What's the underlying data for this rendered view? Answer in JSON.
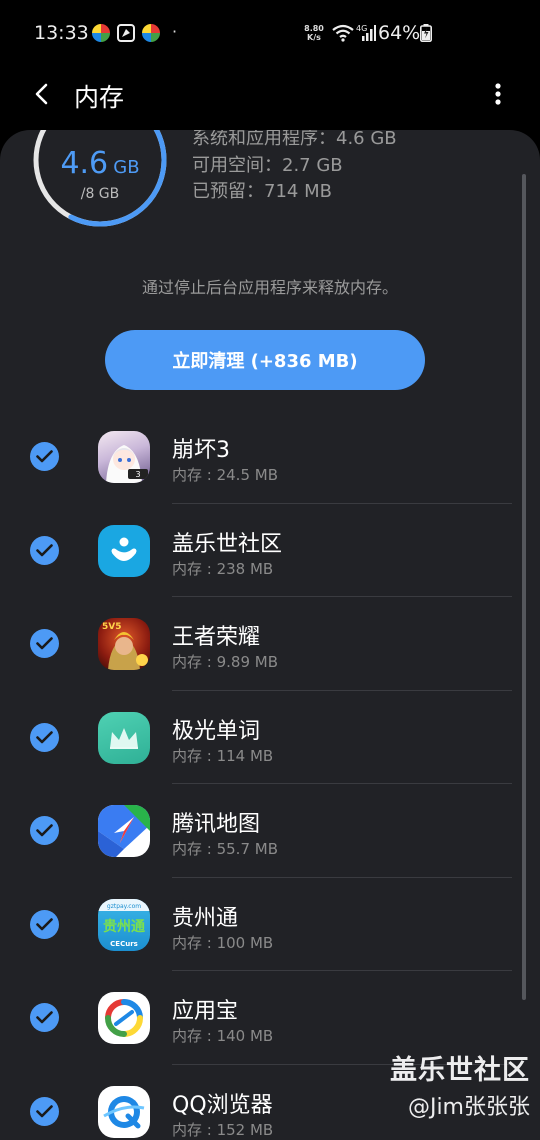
{
  "status_bar": {
    "time": "13:33",
    "dot": "·",
    "net_speed_value": "8.80",
    "net_speed_unit": "K/s",
    "network_type": "4G",
    "battery_percent": "64%"
  },
  "app_bar": {
    "title": "内存",
    "back_icon": "chevron-left-icon",
    "more_icon": "more-vert-icon"
  },
  "memory": {
    "used_value": "4.6",
    "used_unit": "GB",
    "total": "/8 GB",
    "used_fraction": 0.575,
    "stats": [
      "系统和应用程序：4.6 GB",
      "可用空间：2.7 GB",
      "已预留：714 MB"
    ]
  },
  "hint": "通过停止后台应用程序来释放内存。",
  "clean_button_label": "立即清理 (+836 MB)",
  "apps": [
    {
      "name": "崩坏3",
      "memory": "内存 : 24.5 MB",
      "checked": true,
      "icon": "honkai-icon"
    },
    {
      "name": "盖乐世社区",
      "memory": "内存 : 238 MB",
      "checked": true,
      "icon": "galaxy-community-icon"
    },
    {
      "name": "王者荣耀",
      "memory": "内存 : 9.89 MB",
      "checked": true,
      "icon": "honor-of-kings-icon"
    },
    {
      "name": "极光单词",
      "memory": "内存 : 114 MB",
      "checked": true,
      "icon": "aurora-words-icon"
    },
    {
      "name": "腾讯地图",
      "memory": "内存 : 55.7 MB",
      "checked": true,
      "icon": "tencent-map-icon"
    },
    {
      "name": "贵州通",
      "memory": "内存 : 100 MB",
      "checked": true,
      "icon": "guizhou-tong-icon"
    },
    {
      "name": "应用宝",
      "memory": "内存 : 140 MB",
      "checked": true,
      "icon": "app-store-icon"
    },
    {
      "name": "QQ浏览器",
      "memory": "内存 : 152 MB",
      "checked": true,
      "icon": "qq-browser-icon"
    }
  ],
  "icon_text": {
    "guizhou_top": "gztpay.com",
    "guizhou_main": "贵州通",
    "guizhou_bottom": "CECurs",
    "honkai_badge": "3",
    "kings_badge": "5V5"
  },
  "watermark": {
    "line1": "盖乐世社区",
    "line2": "@Jim张张张"
  },
  "colors": {
    "accent": "#4d9af5",
    "card_bg": "#212226",
    "page_bg": "#000000"
  }
}
